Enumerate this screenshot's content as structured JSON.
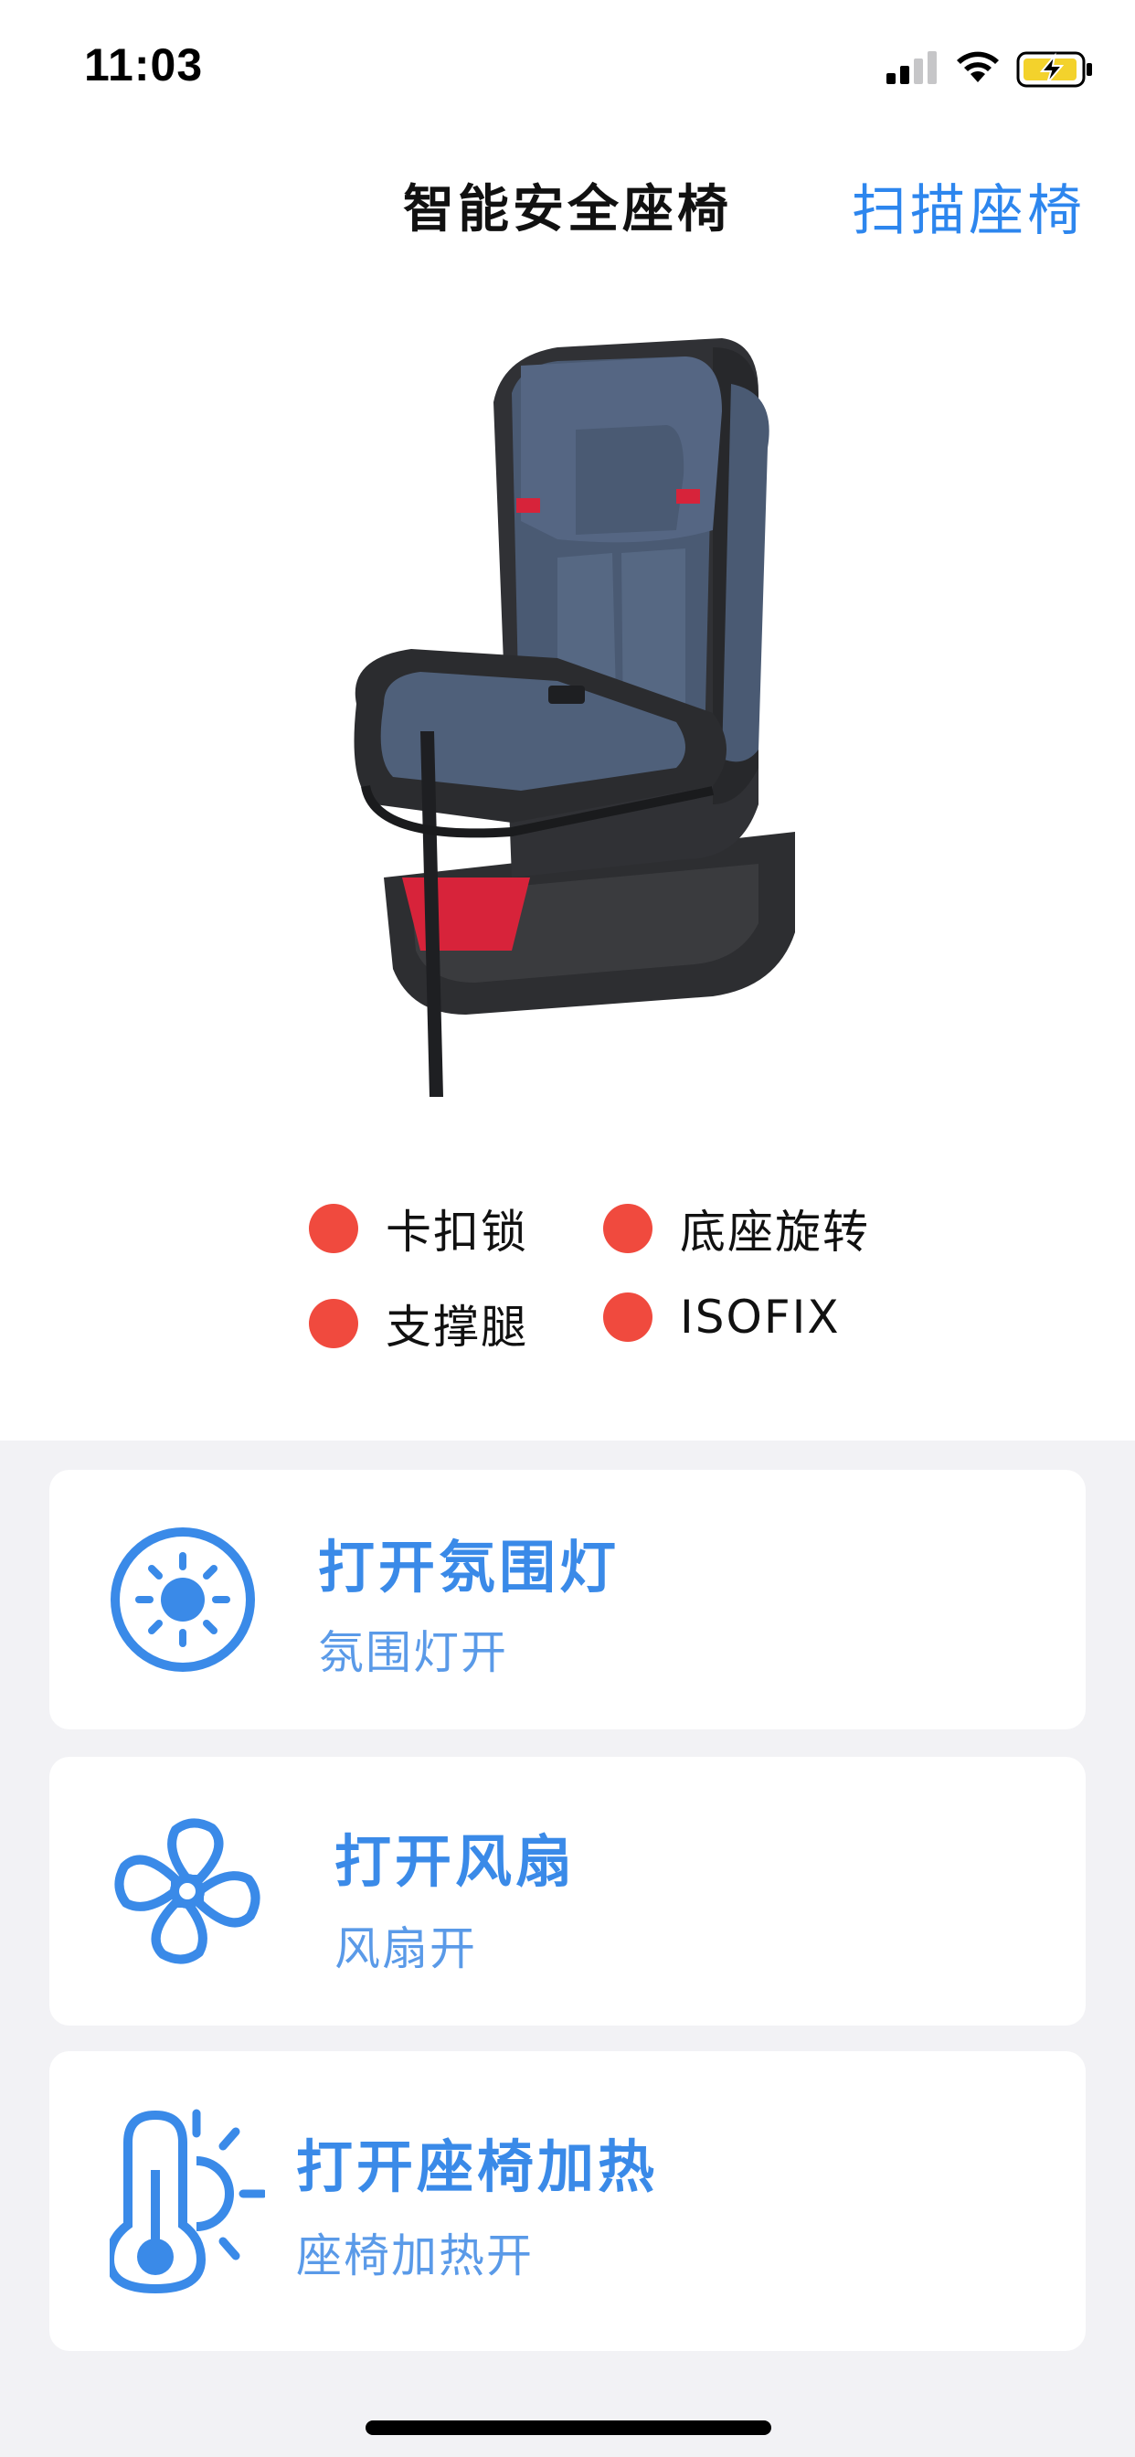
{
  "status_bar": {
    "time": "11:03"
  },
  "nav": {
    "title": "智能安全座椅",
    "action_label": "扫描座椅"
  },
  "indicators": [
    {
      "label": "卡扣锁",
      "color": "#f04a3e"
    },
    {
      "label": "底座旋转",
      "color": "#f04a3e"
    },
    {
      "label": "支撑腿",
      "color": "#f04a3e"
    },
    {
      "label": "ISOFIX",
      "color": "#f04a3e"
    }
  ],
  "controls": [
    {
      "title": "打开氛围灯",
      "subtitle": "氛围灯开",
      "icon": "sun-icon"
    },
    {
      "title": "打开风扇",
      "subtitle": "风扇开",
      "icon": "fan-icon"
    },
    {
      "title": "打开座椅加热",
      "subtitle": "座椅加热开",
      "icon": "thermometer-heat-icon"
    }
  ],
  "colors": {
    "accent": "#2d86ee",
    "card_text": "#3a8ae8",
    "indicator_red": "#f04a3e",
    "background": "#f2f2f5"
  }
}
